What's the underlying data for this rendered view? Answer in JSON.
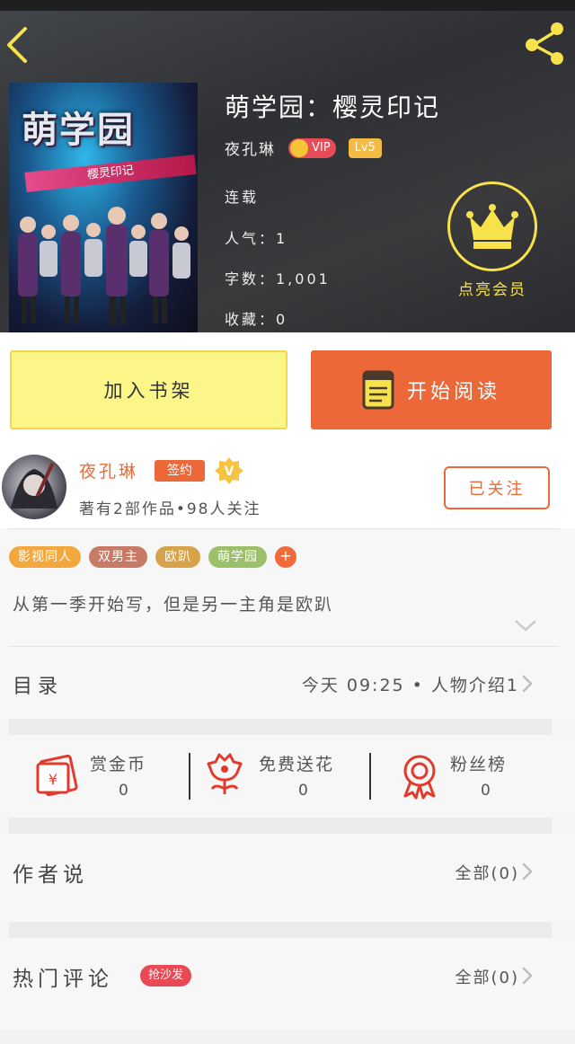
{
  "book": {
    "title": "萌学园：樱灵印记",
    "author": "夜孔琳",
    "vip_label": "VIP",
    "level_label": "Lv5",
    "status": "连载",
    "popularity": "人气：1",
    "word_count": "字数：1,001",
    "favorites": "收藏：0",
    "vip_action_label": "点亮会员",
    "cover_title": "萌学园",
    "cover_subtitle": "樱灵印记"
  },
  "actions": {
    "add_shelf_label": "加入书架",
    "start_reading_label": "开始阅读"
  },
  "author_card": {
    "name": "夜孔琳",
    "sign_label": "签约",
    "stats": "著有2部作品•98人关注",
    "follow_label": "已关注"
  },
  "tags": [
    {
      "label": "影视同人",
      "color": "#f3a73d"
    },
    {
      "label": "双男主",
      "color": "#c77b66"
    },
    {
      "label": "欧趴",
      "color": "#d6a34a"
    },
    {
      "label": "萌学园",
      "color": "#9cc06a"
    }
  ],
  "tag_more_label": "+",
  "description": "从第一季开始写，但是另一主角是欧趴",
  "toc": {
    "label": "目录",
    "latest": "今天 09:25 • 人物介绍1"
  },
  "gifts": {
    "coins": {
      "label": "赏金币",
      "count": "0"
    },
    "flowers": {
      "label": "免费送花",
      "count": "0"
    },
    "fans": {
      "label": "粉丝榜",
      "count": "0"
    }
  },
  "author_says": {
    "title": "作者说",
    "more": "全部(0)"
  },
  "hot_comments": {
    "title": "热门评论",
    "badge": "抢沙发",
    "more": "全部(0)"
  },
  "colors": {
    "accent": "#ec6838",
    "shelf_bg": "#fcf688",
    "vip_gold": "#f7e24b"
  }
}
